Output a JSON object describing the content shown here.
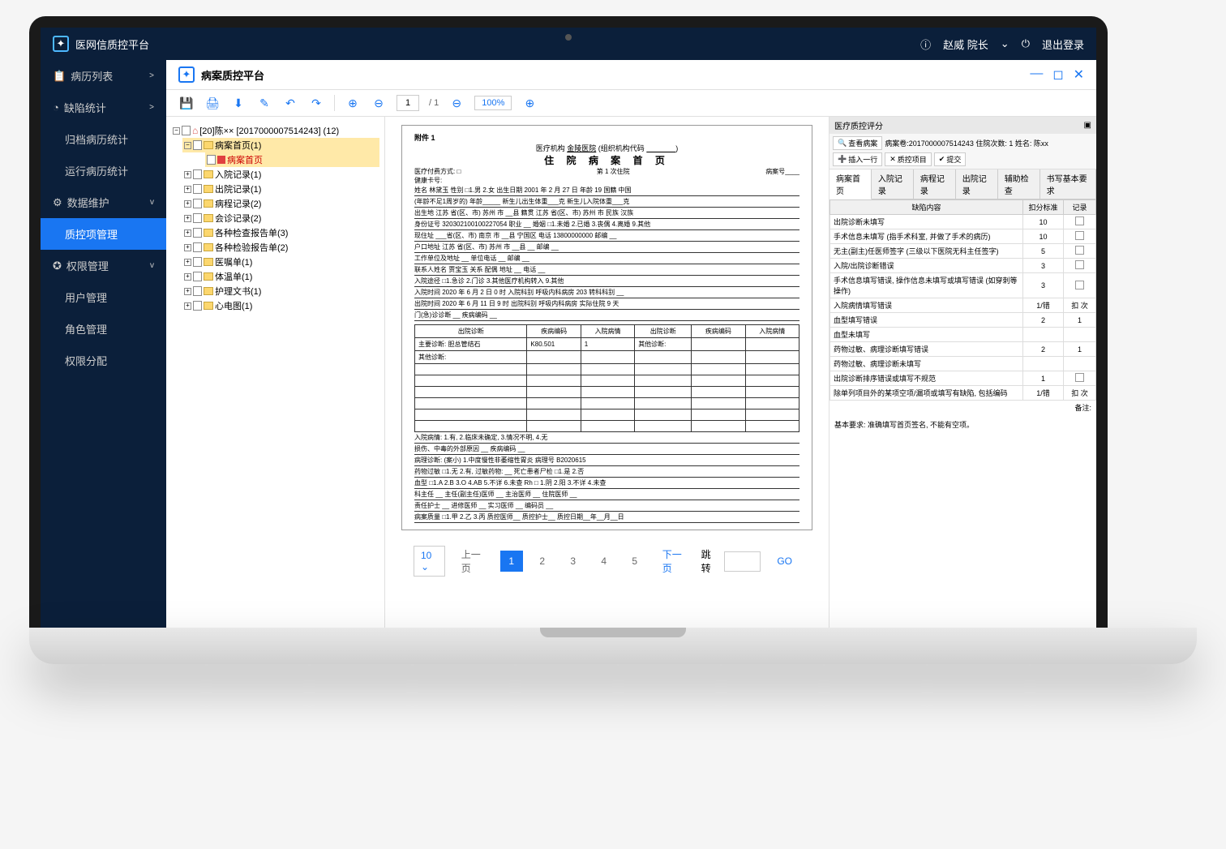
{
  "topbar": {
    "app_title": "医网信质控平台",
    "user": "赵威 院长",
    "logout": "退出登录"
  },
  "sidebar": {
    "items": [
      {
        "label": "病历列表",
        "chev": ">"
      },
      {
        "label": "缺陷统计",
        "chev": ">"
      },
      {
        "label": "归档病历统计"
      },
      {
        "label": "运行病历统计"
      },
      {
        "label": "数据维护",
        "chev": "v"
      },
      {
        "label": "质控项管理",
        "active": true
      },
      {
        "label": "权限管理",
        "chev": "v"
      },
      {
        "label": "用户管理"
      },
      {
        "label": "角色管理"
      },
      {
        "label": "权限分配"
      }
    ]
  },
  "content_header": {
    "title": "病案质控平台"
  },
  "toolbar": {
    "page_current": "1",
    "page_total": "/ 1",
    "zoom": "100%"
  },
  "tree": {
    "root": "[20]陈×× [2017000007514243] (12)",
    "nodes": [
      {
        "label": "病案首页(1)",
        "open": true,
        "child": "病案首页"
      },
      {
        "label": "入院记录(1)"
      },
      {
        "label": "出院记录(1)"
      },
      {
        "label": "病程记录(2)"
      },
      {
        "label": "会诊记录(2)"
      },
      {
        "label": "各种检查报告单(3)"
      },
      {
        "label": "各种检验报告单(2)"
      },
      {
        "label": "医嘱单(1)"
      },
      {
        "label": "体温单(1)"
      },
      {
        "label": "护理文书(1)"
      },
      {
        "label": "心电图(1)"
      }
    ]
  },
  "document": {
    "attachment": "附件 1",
    "org_label": "医疗机构",
    "org": "金陵医院",
    "org_code_label": "(组织机构代码",
    "org_code_end": ")",
    "title": "住 院 病 案 首 页",
    "pay_label": "医疗付费方式: □",
    "visit_label": "第 1 次住院",
    "case_no_label": "病案号",
    "health_card": "健康卡号:",
    "info_lines": [
      "姓名  林黛玉   性别 □1.男 2.女   出生日期 2001 年 2 月 27 日   年龄  19    国籍 中国",
      "(年龄不足1周岁的) 年龄_____    新生儿出生体重___克    新生儿入院体重___克",
      "出生地 江苏 省(区、市) 苏州 市 __县 籍贯 江苏 省(区、市) 苏州 市 民族 汉族",
      "身份证号 320302100100227054    职业 __    婚姻 □1.未婚 2.已婚 3.丧偶 4.离婚 9.其他",
      "现住址 ___省(区、市) 南京 市 __县 宁国区  电话 13800000000 邮编 __",
      "户口地址 江苏 省(区、市) 苏州 市 __县 __    邮编 __",
      "工作单位及地址 __    单位电话 __    邮编 __",
      "联系人姓名 贾宝玉  关系 配偶  地址 __   电话 __"
    ],
    "admit_lines": [
      "入院途径 □1.急诊 2.门诊 3.其他医疗机构转入 9.其他",
      "入院时间 2020 年 6 月 2 日 0 时   入院科别 呼吸内科病房 203   转科科别 __",
      "出院时间 2020 年 6 月 11 日 9 时   出院科别 呼吸内科病房   实际住院 9 天",
      "门(急)诊诊断 __    疾病编码 __"
    ],
    "diag_headers": [
      "出院诊断",
      "疾病编码",
      "入院病情",
      "出院诊断",
      "疾病编码",
      "入院病情"
    ],
    "main_diag_label": "主要诊断:",
    "main_diag": "胆总管结石",
    "main_diag_code": "K80.501",
    "main_diag_cond": "1",
    "other_diag_label": "其他诊断:",
    "bottom_lines": [
      "入院病情: 1.有, 2.临床未确定, 3.情况不明, 4.无",
      "损伤、中毒的外部原因 __    疾病编码 __",
      "病理诊断: (案小) 1.中度慢性非萎缩性胃炎    病理号 B2020615",
      "药物过敏 □1.无 2.有, 过敏药物: __    死亡患者尸检 □1.是 2.否",
      "血型 □1.A 2.B 3.O 4.AB 5.不详 6.未查  Rh □ 1.阴 2.阳 3.不详 4.未查",
      "科主任 __  主任(副主任)医师 __  主治医师 __  住院医师 __",
      "责任护士 __  进修医师 __  实习医师 __  编码员 __",
      "病案质量 □1.甲 2.乙 3.丙 质控医师__ 质控护士__ 质控日期__年__月__日"
    ]
  },
  "pagination": {
    "size": "10",
    "prev": "上一页",
    "pages": [
      "1",
      "2",
      "3",
      "4",
      "5"
    ],
    "next": "下一页",
    "jump": "跳转",
    "go": "GO"
  },
  "qc": {
    "title": "医疗质控评分",
    "search_btn": "查看病案",
    "case_info": "病案卷:2017000007514243  住院次数: 1  姓名: 陈xx",
    "insert_btn": "插入一行",
    "del_btn": "质控项目",
    "save_btn": "提交",
    "tabs": [
      "病案首页",
      "入院记录",
      "病程记录",
      "出院记录",
      "辅助检查",
      "书写基本要求"
    ],
    "headers": [
      "缺陷内容",
      "扣分标准",
      "记录"
    ],
    "rows": [
      {
        "c": "出院诊断未填写",
        "s": "10",
        "r": "☐"
      },
      {
        "c": "手术信息未填写 (指手术科室, 并做了手术的病历)",
        "s": "10",
        "r": "☐"
      },
      {
        "c": "无主(副主)任医师签字 (三级以下医院无科主任签字)",
        "s": "5",
        "r": "☐"
      },
      {
        "c": "入院/出院诊断错误",
        "s": "3",
        "r": "☐"
      },
      {
        "c": "手术信息填写错误, 操作信息未填写或填写错误 (如穿刺等操作)",
        "s": "3",
        "r": "☐"
      },
      {
        "c": "入院病情填写错误",
        "s": "1/错",
        "r": "扣 次"
      },
      {
        "c": "血型填写错误",
        "s": "2",
        "r": "1"
      },
      {
        "c": "血型未填写",
        "s": "",
        "r": ""
      },
      {
        "c": "药物过敏、病理诊断填写错误",
        "s": "2",
        "r": "1"
      },
      {
        "c": "药物过敏、病理诊断未填写",
        "s": "",
        "r": ""
      },
      {
        "c": "出院诊断排序错误或填写不规范",
        "s": "1",
        "r": "☐"
      },
      {
        "c": "除单列项目外的某项空项/漏项或填写有缺陷, 包括编码",
        "s": "1/错",
        "r": "扣 次"
      }
    ],
    "note_label": "备注:",
    "basic_label": "基本要求: 准确填写首页签名, 不能有空项。"
  }
}
